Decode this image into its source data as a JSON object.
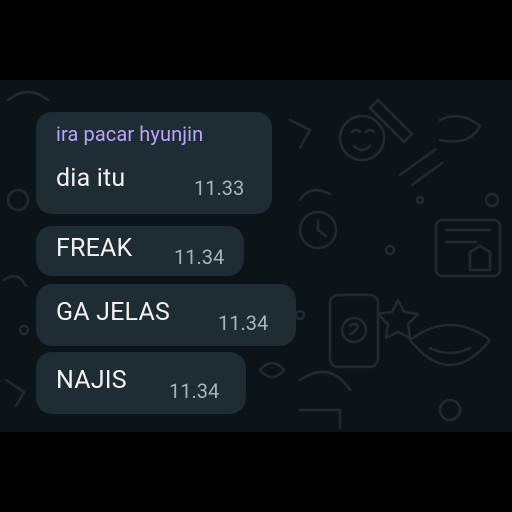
{
  "chat": {
    "messages": [
      {
        "sender": "ira pacar hyunjin",
        "text": "dia itu",
        "time": "11.33"
      },
      {
        "text": "FREAK",
        "time": "11.34"
      },
      {
        "text": "GA JELAS",
        "time": "11.34"
      },
      {
        "text": "NAJIS",
        "time": "11.34"
      }
    ]
  },
  "colors": {
    "background": "#0d1418",
    "bubble": "#1f2c34",
    "sender_name": "#b7a5ff",
    "message_text": "#f2f2f2",
    "timestamp": "#a9b2b8"
  }
}
